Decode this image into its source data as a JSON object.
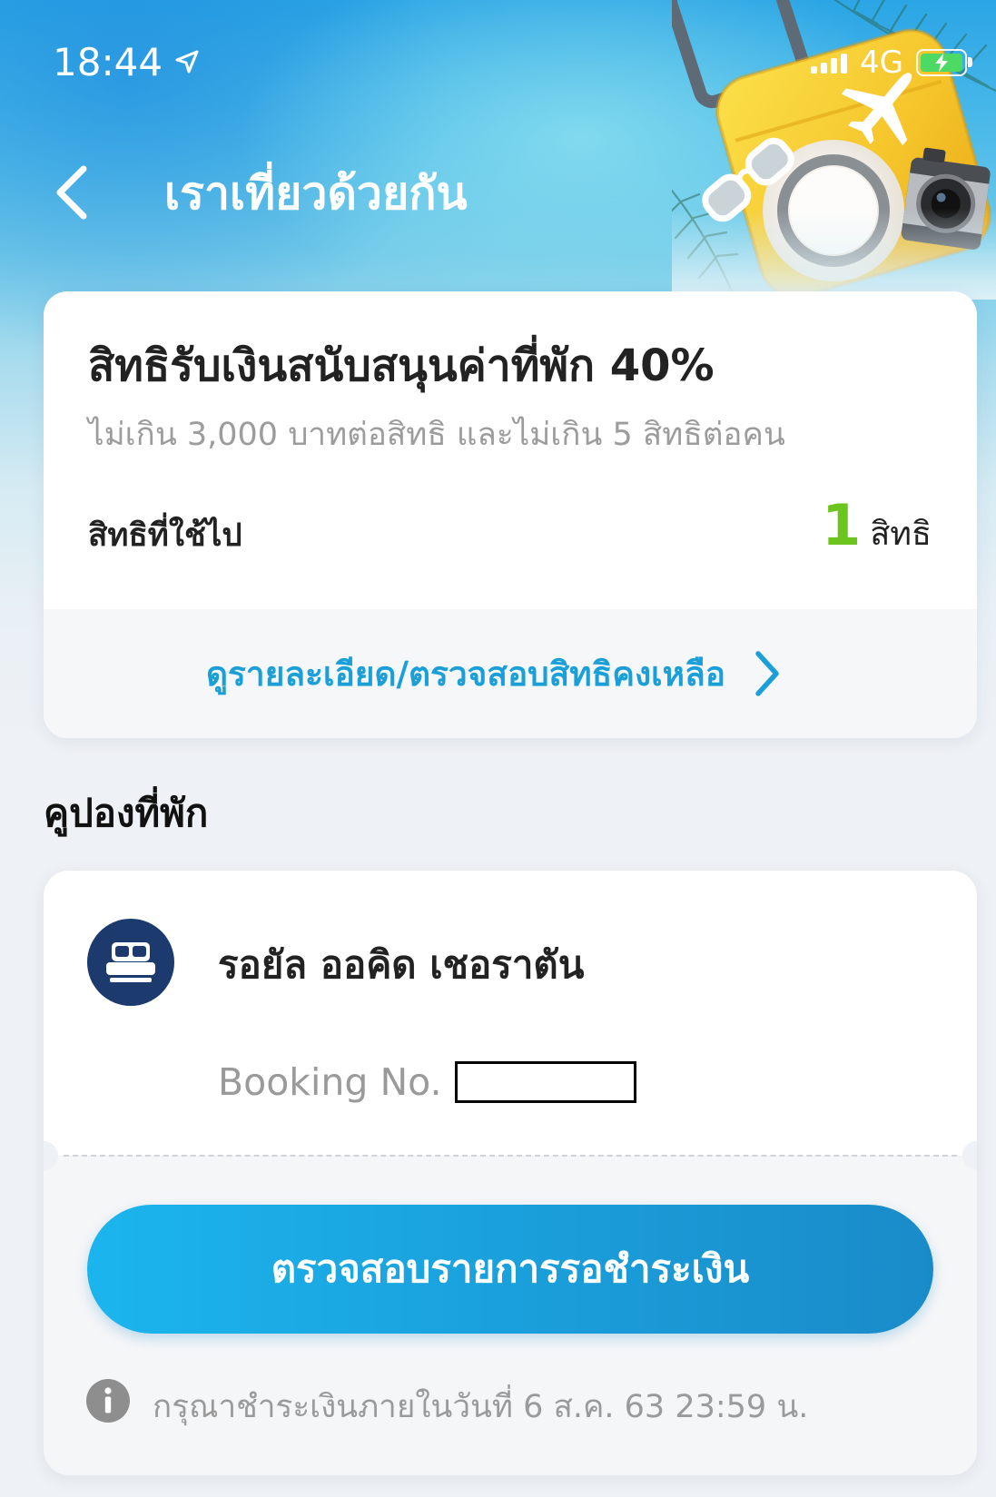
{
  "status_bar": {
    "time": "18:44",
    "network": "4G",
    "icons": {
      "location": "location-arrow-icon",
      "signal": "cellular-signal-icon",
      "battery": "battery-charging-icon"
    }
  },
  "header": {
    "title": "เราเที่ยวด้วยกัน",
    "back_icon": "chevron-left-icon"
  },
  "entitlement_card": {
    "title": "สิทธิรับเงินสนับสนุนค่าที่พัก 40%",
    "subtitle": "ไม่เกิน 3,000 บาทต่อสิทธิ และไม่เกิน 5 สิทธิต่อคน",
    "used_label": "สิทธิที่ใช้ไป",
    "used_count": "1",
    "used_unit": "สิทธิ",
    "details_link": "ดูรายละเอียด/ตรวจสอบสิทธิคงเหลือ",
    "details_icon": "chevron-right-icon"
  },
  "coupon_section": {
    "heading": "คูปองที่พัก",
    "coupons": [
      {
        "hotel_icon": "bed-icon",
        "hotel_name": "รอยัล ออคิด เชอราตัน",
        "booking_label": "Booking No.",
        "action_button": "ตรวจสอบรายการรอชำระเงิน",
        "notice_icon": "info-icon",
        "notice": "กรุณาชำระเงินภายในวันที่ 6 ส.ค. 63 23:59 น."
      }
    ]
  },
  "colors": {
    "accent_blue": "#1b9fd8",
    "used_count_green": "#6cc51c",
    "hotel_icon_bg": "#1c3a6e",
    "button_start": "#1bb5ee",
    "button_end": "#1a8bc9",
    "battery_green": "#4cd964"
  }
}
